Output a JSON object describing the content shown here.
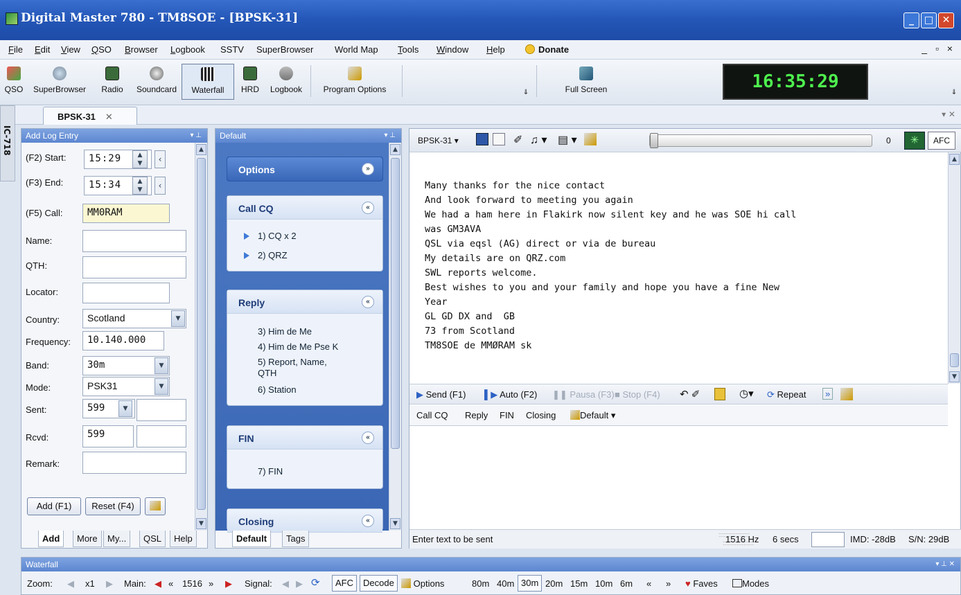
{
  "window": {
    "title": "Digital Master 780 - TM8SOE - [BPSK-31]"
  },
  "menu": [
    "File",
    "Edit",
    "View",
    "QSO",
    "Browser",
    "Logbook",
    "SSTV",
    "SuperBrowser",
    "World Map",
    "Tools",
    "Window",
    "Help"
  ],
  "menu_donate": "Donate",
  "mdi_controls": "_ ▫ ×",
  "toolbar": {
    "qso": "QSO",
    "superbrowser": "SuperBrowser",
    "radio": "Radio",
    "soundcard": "Soundcard",
    "waterfall": "Waterfall",
    "hrd": "HRD",
    "logbook": "Logbook",
    "program_options": "Program Options",
    "full_screen": "Full Screen"
  },
  "clock": "16:35:29",
  "side_tab": "IC-718",
  "doc_tab": "BPSK-31",
  "log": {
    "title": "Add Log Entry",
    "start_label": "(F2) Start:",
    "start_value": "15:29",
    "end_label": "(F3) End:",
    "end_value": "15:34",
    "call_label": "(F5) Call:",
    "call_value": "MM0RAM",
    "name_label": "Name:",
    "qth_label": "QTH:",
    "locator_label": "Locator:",
    "country_label": "Country:",
    "country_value": "Scotland",
    "frequency_label": "Frequency:",
    "frequency_value": "10.140.000",
    "band_label": "Band:",
    "band_value": "30m",
    "mode_label": "Mode:",
    "mode_value": "PSK31",
    "sent_label": "Sent:",
    "sent_value": "599",
    "rcvd_label": "Rcvd:",
    "rcvd_value": "599",
    "remark_label": "Remark:",
    "add_button": "Add (F1)",
    "reset_button": "Reset (F4)",
    "tabs": [
      "Add",
      "More",
      "My...",
      "QSL",
      "Help"
    ]
  },
  "macros": {
    "title": "Default",
    "options": "Options",
    "callcq": {
      "title": "Call CQ",
      "items": [
        "1) CQ x 2",
        "2) QRZ"
      ]
    },
    "reply": {
      "title": "Reply",
      "items": [
        "3) Him de Me",
        "4) Him de Me Pse K",
        "5) Report, Name,",
        "QTH",
        "6) Station"
      ]
    },
    "fin": {
      "title": "FIN",
      "items": [
        "7) FIN"
      ]
    },
    "closing": {
      "title": "Closing"
    },
    "tabs": [
      "Default",
      "Tags"
    ]
  },
  "rx": {
    "mode": "BPSK-31",
    "level": "0",
    "afc": "AFC",
    "lines": [
      "Many thanks for the nice contact",
      "And look forward to meeting you again",
      "We had a ham here in Flakirk now silent key and he was SOE hi call",
      "was GM3AVA",
      "QSL via eqsl (AG) direct or via de bureau",
      "My details are on QRZ.com",
      "SWL reports welcome.",
      "Best wishes to you and your family and hope you have a fine New",
      "Year",
      "GL GD DX and  GB",
      "73 from Scotland",
      "TM8SOE de MMØRAM sk"
    ]
  },
  "send": {
    "send": "Send (F1)",
    "auto": "Auto (F2)",
    "pause": "Pausa (F3)",
    "stop": "Stop (F4)",
    "repeat": "Repeat"
  },
  "macrobar": {
    "items": [
      "Call CQ",
      "Reply",
      "FIN",
      "Closing"
    ],
    "default": "Default"
  },
  "status": {
    "hint": "Enter text to be sent",
    "freq": "1516 Hz",
    "secs": "6 secs",
    "imd": "IMD: -28dB",
    "sn": "S/N: 29dB"
  },
  "wf": {
    "title": "Waterfall",
    "zoom_label": "Zoom:",
    "zoom": "x1",
    "main_label": "Main:",
    "main_value": "1516",
    "signal_label": "Signal:",
    "afc": "AFC",
    "decode": "Decode",
    "options": "Options",
    "bands": [
      "80m",
      "40m",
      "30m",
      "20m",
      "15m",
      "10m",
      "6m"
    ],
    "faves": "Faves",
    "modes": "Modes"
  },
  "colors": {
    "title_bar": "#2457b8",
    "clock_text": "#4ef04e",
    "macro_panel": "#3a66b4"
  }
}
